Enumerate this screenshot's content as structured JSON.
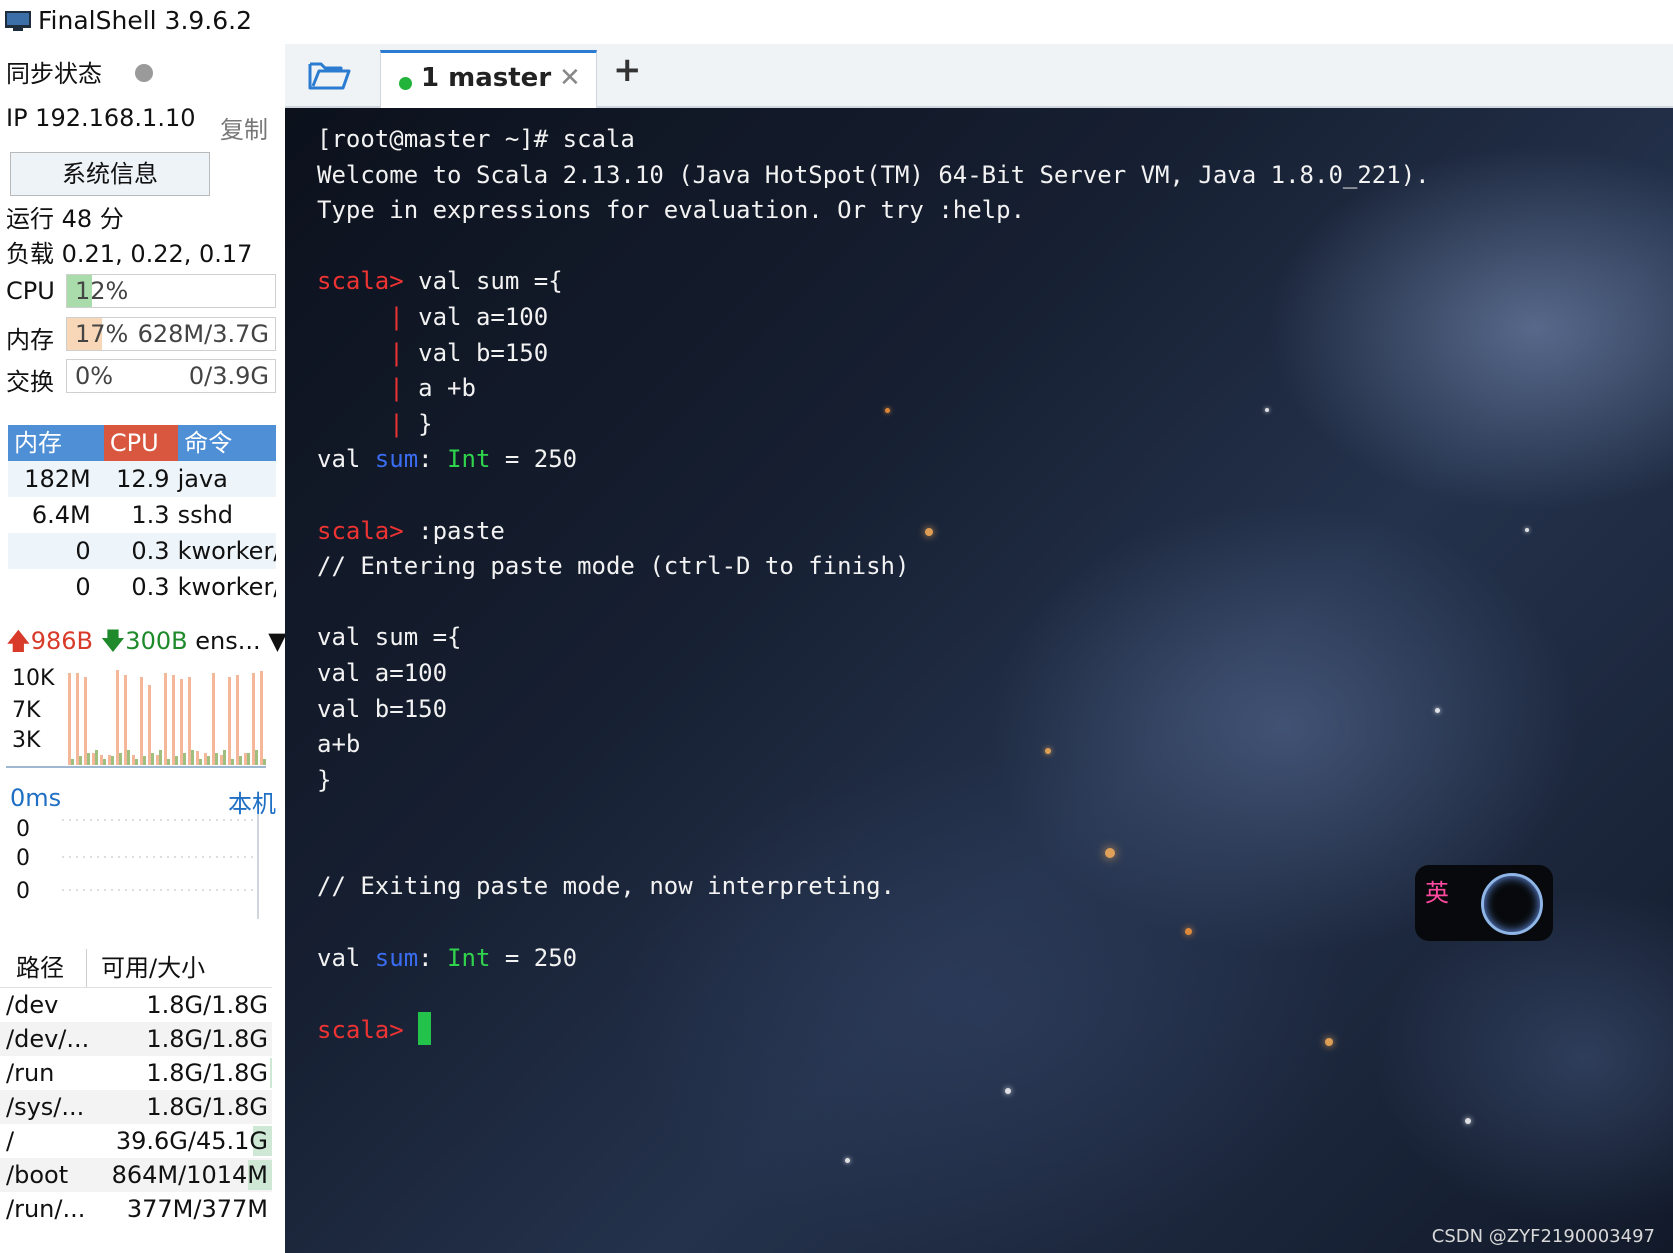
{
  "window": {
    "title": "FinalShell 3.9.6.2"
  },
  "sidebar": {
    "sync_label": "同步状态",
    "ip": "IP 192.168.1.10",
    "copy": "复制",
    "sysinfo_button": "系统信息",
    "uptime": "运行 48 分",
    "load": "负载 0.21, 0.22, 0.17",
    "cpu": {
      "label": "CPU",
      "percent_text": "12%",
      "fill": 0.12
    },
    "memory": {
      "label": "内存",
      "percent_text": "17%",
      "detail": "628M/3.7G",
      "fill": 0.17
    },
    "swap": {
      "label": "交换",
      "percent_text": "0%",
      "detail": "0/3.9G",
      "fill": 0.0
    },
    "process_table": {
      "headers": [
        "内存",
        "CPU",
        "命令"
      ],
      "rows": [
        {
          "mem": "182M",
          "cpu": "12.9",
          "cmd": "java"
        },
        {
          "mem": "6.4M",
          "cpu": "1.3",
          "cmd": "sshd"
        },
        {
          "mem": "0",
          "cpu": "0.3",
          "cmd": "kworker/"
        },
        {
          "mem": "0",
          "cpu": "0.3",
          "cmd": "kworker/"
        }
      ]
    },
    "network": {
      "up": "986B",
      "down": "300B",
      "interface": "ens...",
      "y_labels": [
        "10K",
        "7K",
        "3K"
      ]
    },
    "latency": {
      "value": "0ms",
      "host": "本机",
      "y_labels": [
        "0",
        "0",
        "0"
      ]
    },
    "disk_table": {
      "headers": [
        "路径",
        "可用/大小"
      ],
      "rows": [
        {
          "path": "/dev",
          "size": "1.8G/1.8G",
          "used": 0.0
        },
        {
          "path": "/dev/...",
          "size": "1.8G/1.8G",
          "used": 0.0
        },
        {
          "path": "/run",
          "size": "1.8G/1.8G",
          "used": 0.01
        },
        {
          "path": "/sys/...",
          "size": "1.8G/1.8G",
          "used": 0.0
        },
        {
          "path": "/",
          "size": "39.6G/45.1G",
          "used": 0.12
        },
        {
          "path": "/boot",
          "size": "864M/1014M",
          "used": 0.15
        },
        {
          "path": "/run/...",
          "size": "377M/377M",
          "used": 0.0
        }
      ]
    }
  },
  "tabs": [
    {
      "label": "1 master",
      "active": true
    }
  ],
  "terminal": {
    "l1": "[root@master ~]# scala",
    "l2": "Welcome to Scala 2.13.10 (Java HotSpot(TM) 64-Bit Server VM, Java 1.8.0_221).",
    "l3": "Type in expressions for evaluation. Or try :help.",
    "prompt": "scala>",
    "cont": "|",
    "l5": " val sum ={",
    "l6": " val a=100",
    "l7": " val b=150",
    "l8": " a +b",
    "l9": " }",
    "res_val": "val ",
    "res_name": "sum",
    "res_colon": ": ",
    "res_type": "Int",
    "res_value": " = 250",
    "l12": " :paste",
    "l13": "// Entering paste mode (ctrl-D to finish)",
    "p1": "val sum ={",
    "p2": "val a=100",
    "p3": "val b=150",
    "p4": "a+b",
    "p5": "}",
    "l20": "// Exiting paste mode, now interpreting."
  },
  "ime": {
    "char": "英"
  },
  "watermark": "CSDN @ZYF2190003497",
  "colors": {
    "accent": "#2b7bd1",
    "prompt": "#ee3333",
    "type": "#2fd44c",
    "name": "#3a6cf0",
    "cpu_fill": "#a9dcaa",
    "mem_fill": "#f8d6b8"
  }
}
